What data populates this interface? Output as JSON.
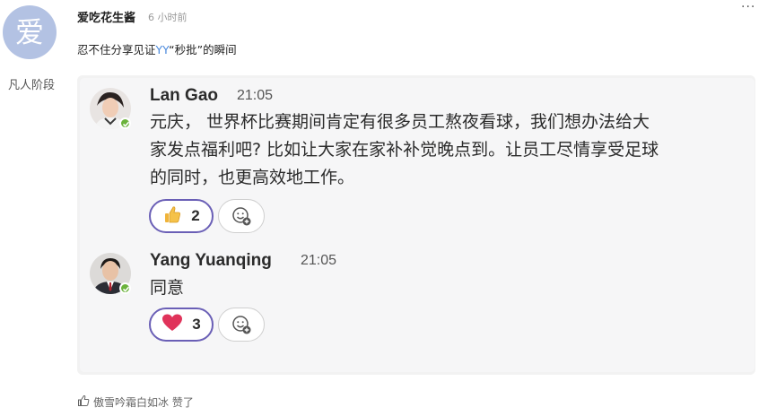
{
  "post": {
    "avatar_char": "爱",
    "author": "爱吃花生酱",
    "time": "6 小时前",
    "rank": "凡人阶段",
    "more": "···",
    "text_before": "忍不住分享见证",
    "text_highlight": "YY",
    "text_quote_open": "“",
    "text_quote_word": "秒批",
    "text_quote_close": "”",
    "text_after": "的瞬间"
  },
  "messages": [
    {
      "sender": "Lan Gao",
      "time": "21:05",
      "lines": [
        "元庆， 世界杯比赛期间肯定有很多员工熬夜看球，我们想办法给大",
        "家发点福利吧? 比如让大家在家补补觉晚点到。让员工尽情享受足球",
        "的同时，也更高效地工作。"
      ],
      "reaction_icon": "thumbs-up-icon",
      "reaction_count": "2"
    },
    {
      "sender": "Yang Yuanqing",
      "time": "21:05",
      "lines": [
        "同意"
      ],
      "reaction_icon": "heart-icon",
      "reaction_count": "3"
    }
  ],
  "footer": {
    "like_icon": "thumbs-up-outline-icon",
    "text": "傲雪吟霜白如冰 赞了"
  },
  "colors": {
    "avatar_bg": "#b3c2e3",
    "highlight": "#4a89dc",
    "reaction_border": "#6a5fb6",
    "status_green": "#6bb33c",
    "heart": "#e0335a"
  }
}
